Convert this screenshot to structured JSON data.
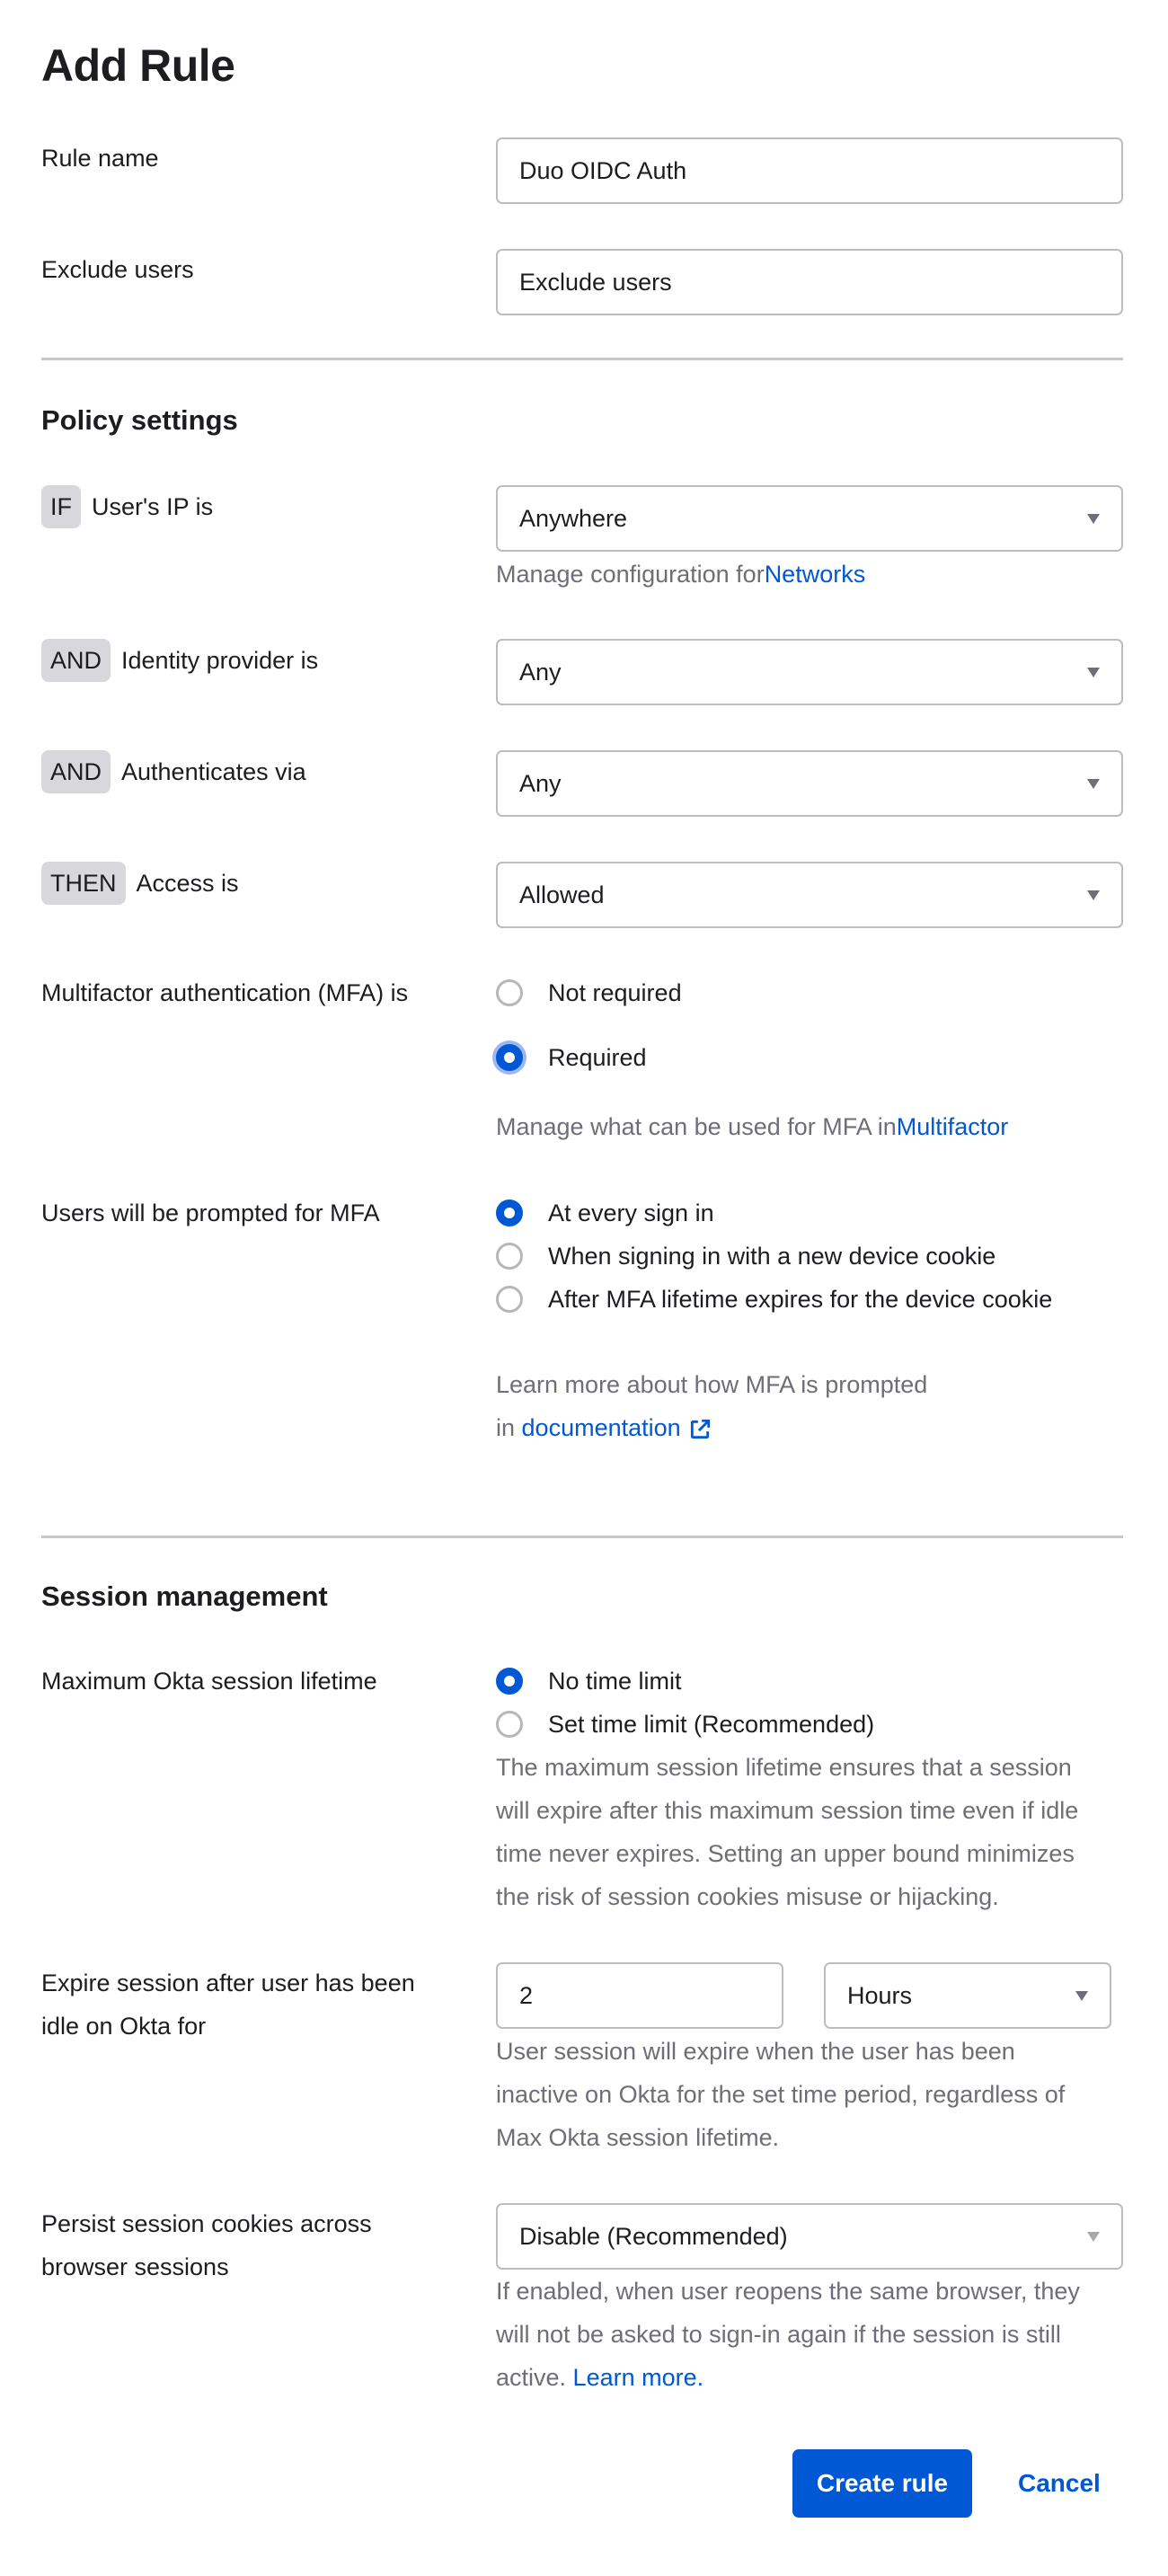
{
  "page": {
    "title": "Add Rule"
  },
  "general": {
    "rule_name_label": "Rule name",
    "rule_name_value": "Duo OIDC Auth",
    "exclude_users_label": "Exclude users",
    "exclude_users_placeholder": "Exclude users"
  },
  "policy": {
    "section_title": "Policy settings",
    "conditions": [
      {
        "badge": "IF",
        "label": "User's IP is",
        "value": "Anywhere"
      },
      {
        "badge": "AND",
        "label": "Identity provider is",
        "value": "Any"
      },
      {
        "badge": "AND",
        "label": "Authenticates via",
        "value": "Any"
      },
      {
        "badge": "THEN",
        "label": "Access is",
        "value": "Allowed"
      }
    ],
    "networks_help_prefix": "Manage configuration for",
    "networks_link": "Networks",
    "mfa": {
      "label": "Multifactor authentication (MFA) is",
      "options": [
        {
          "label": "Not required",
          "checked": false
        },
        {
          "label": "Required",
          "checked": true
        }
      ],
      "help_prefix": "Manage what can be used for MFA in",
      "help_link": "Multifactor"
    },
    "prompt": {
      "label": "Users will be prompted for MFA",
      "options": [
        {
          "label": "At every sign in",
          "checked": true
        },
        {
          "label": "When signing in with a new device cookie",
          "checked": false
        },
        {
          "label": "After MFA lifetime expires for the device cookie",
          "checked": false
        }
      ],
      "help_line1": "Learn more about how MFA is prompted",
      "help_line2_prefix": "in",
      "help_link": "documentation",
      "help_link_icon": "external-link-icon"
    }
  },
  "session": {
    "section_title": "Session management",
    "max_lifetime": {
      "label": "Maximum Okta session lifetime",
      "options": [
        {
          "label": "No time limit",
          "checked": true
        },
        {
          "label": "Set time limit (Recommended)",
          "checked": false
        }
      ],
      "help_lines": [
        "The maximum session lifetime ensures that a session",
        "will expire after this maximum session time even if idle",
        "time never expires. Setting an upper bound minimizes",
        "the risk of session cookies misuse or hijacking."
      ]
    },
    "idle": {
      "label_line1": "Expire session after user has been",
      "label_line2": "idle on Okta for",
      "value": "2",
      "unit": "Hours",
      "help_lines": [
        "User session will expire when the user has been",
        "inactive on Okta for the set time period, regardless of",
        "Max Okta session lifetime."
      ]
    },
    "persist": {
      "label_line1": "Persist session cookies across",
      "label_line2": "browser sessions",
      "value": "Disable (Recommended)",
      "help_lines": [
        "If enabled, when user reopens the same browser, they",
        "will not be asked to sign-in again if the session is still"
      ],
      "help_last_prefix": "active. ",
      "help_link": "Learn more."
    }
  },
  "actions": {
    "create_label": "Create rule",
    "cancel_label": "Cancel"
  },
  "colors": {
    "accent": "#0058d4",
    "text": "#1d1d21",
    "muted": "#6e6e78",
    "border": "#bcbcc2",
    "badge_bg": "#d7d7dc"
  }
}
